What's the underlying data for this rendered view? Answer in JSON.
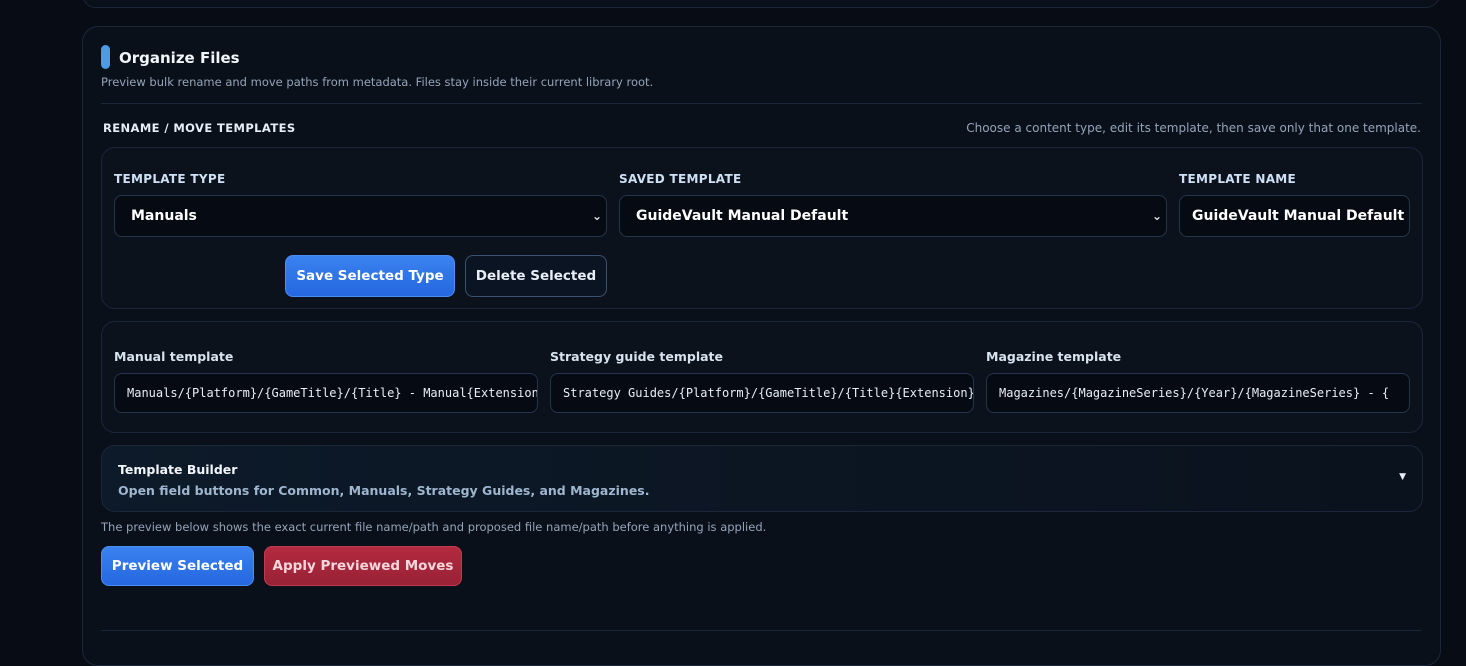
{
  "organize": {
    "title": "Organize Files",
    "subtitle": "Preview bulk rename and move paths from metadata. Files stay inside their current library root.",
    "section_label": "RENAME / MOVE TEMPLATES",
    "section_hint": "Choose a content type, edit its template, then save only that one template.",
    "template_type": {
      "label": "TEMPLATE TYPE",
      "value": "Manuals"
    },
    "saved_template": {
      "label": "SAVED TEMPLATE",
      "value": "GuideVault Manual Default"
    },
    "template_name": {
      "label": "TEMPLATE NAME",
      "value": "GuideVault Manual Default"
    },
    "save_button": "Save Selected Type",
    "delete_button": "Delete Selected",
    "templates": {
      "manual": {
        "label": "Manual template",
        "value": "Manuals/{Platform}/{GameTitle}/{Title} - Manual{Extension}"
      },
      "strategy": {
        "label": "Strategy guide template",
        "value": "Strategy Guides/{Platform}/{GameTitle}/{Title}{Extension}"
      },
      "magazine": {
        "label": "Magazine template",
        "value": "Magazines/{MagazineSeries}/{Year}/{MagazineSeries} - {"
      }
    },
    "builder": {
      "title": "Template Builder",
      "subtitle": "Open field buttons for Common, Manuals, Strategy Guides, and Magazines."
    },
    "preview_note": "The preview below shows the exact current file name/path and proposed file name/path before anything is applied.",
    "preview_button": "Preview Selected",
    "apply_button": "Apply Previewed Moves"
  },
  "colors": {
    "accent": "#4a9be8",
    "primary": "#2f74e8",
    "danger": "#a8263b",
    "background": "#080d15"
  }
}
